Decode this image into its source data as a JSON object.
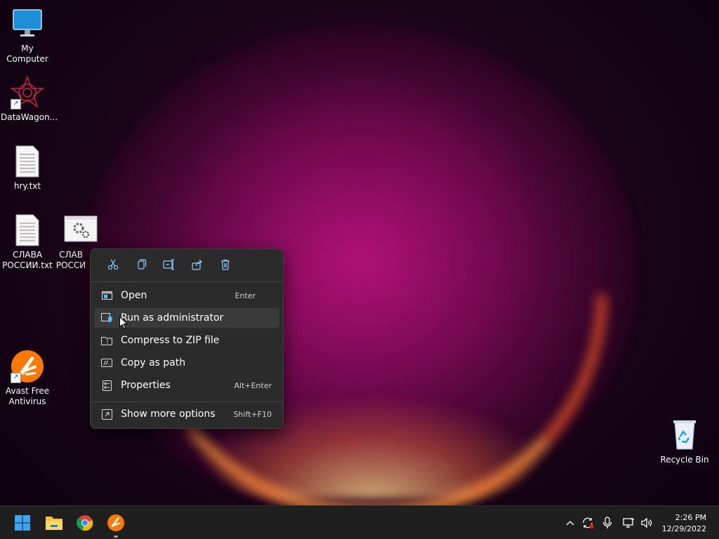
{
  "desktop": {
    "icons": [
      {
        "label": "My Computer"
      },
      {
        "label": "DataWagon..."
      },
      {
        "label": "hry.txt"
      },
      {
        "label": "СЛАВА РОССИИ.txt"
      },
      {
        "label": "СЛАВ РОССИ"
      },
      {
        "label": "Avast Free Antivirus"
      },
      {
        "label": "Recycle Bin"
      }
    ]
  },
  "context_menu": {
    "toolbar": [
      "cut-icon",
      "copy-icon",
      "rename-icon",
      "share-icon",
      "delete-icon"
    ],
    "items": [
      {
        "label": "Open",
        "shortcut": "Enter",
        "icon": "open-window-icon"
      },
      {
        "label": "Run as administrator",
        "shortcut": "",
        "icon": "shield-window-icon"
      },
      {
        "label": "Compress to ZIP file",
        "shortcut": "",
        "icon": "zip-folder-icon"
      },
      {
        "label": "Copy as path",
        "shortcut": "",
        "icon": "copy-path-icon"
      },
      {
        "label": "Properties",
        "shortcut": "Alt+Enter",
        "icon": "properties-icon"
      },
      {
        "label": "Show more options",
        "shortcut": "Shift+F10",
        "icon": "more-options-icon"
      }
    ],
    "highlighted_item": "Run as administrator"
  },
  "taskbar": {
    "apps": [
      "start-icon",
      "file-explorer-icon",
      "chrome-icon",
      "avast-icon"
    ],
    "tray": [
      "chevron-up-icon",
      "sync-icon",
      "microphone-icon",
      "network-icon",
      "volume-icon"
    ],
    "time": "2:26 PM",
    "date": "12/29/2022"
  },
  "colors": {
    "menu_bg": "#2b2b2b",
    "taskbar_bg": "#1f1f1f",
    "accent": "#4cc2ff"
  }
}
